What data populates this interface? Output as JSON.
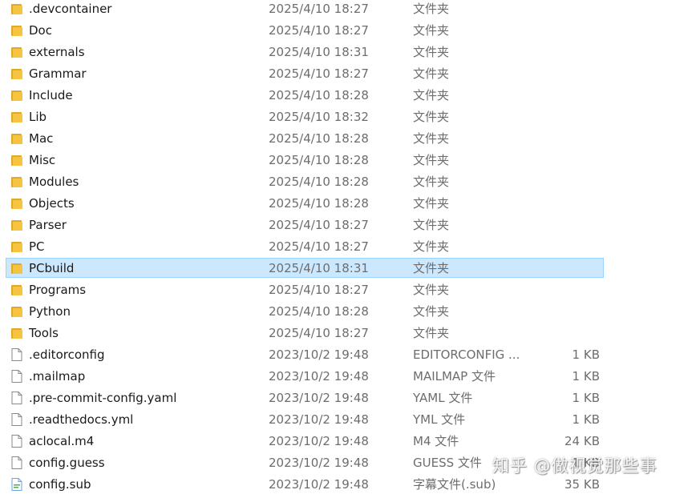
{
  "files": [
    {
      "name": ".devcontainer",
      "date": "2025/4/10 18:27",
      "type": "文件夹",
      "size": "",
      "icon": "folder-icon"
    },
    {
      "name": "Doc",
      "date": "2025/4/10 18:27",
      "type": "文件夹",
      "size": "",
      "icon": "folder-icon"
    },
    {
      "name": "externals",
      "date": "2025/4/10 18:31",
      "type": "文件夹",
      "size": "",
      "icon": "folder-icon"
    },
    {
      "name": "Grammar",
      "date": "2025/4/10 18:27",
      "type": "文件夹",
      "size": "",
      "icon": "folder-icon"
    },
    {
      "name": "Include",
      "date": "2025/4/10 18:28",
      "type": "文件夹",
      "size": "",
      "icon": "folder-icon"
    },
    {
      "name": "Lib",
      "date": "2025/4/10 18:32",
      "type": "文件夹",
      "size": "",
      "icon": "folder-icon"
    },
    {
      "name": "Mac",
      "date": "2025/4/10 18:28",
      "type": "文件夹",
      "size": "",
      "icon": "folder-icon"
    },
    {
      "name": "Misc",
      "date": "2025/4/10 18:28",
      "type": "文件夹",
      "size": "",
      "icon": "folder-icon"
    },
    {
      "name": "Modules",
      "date": "2025/4/10 18:28",
      "type": "文件夹",
      "size": "",
      "icon": "folder-icon"
    },
    {
      "name": "Objects",
      "date": "2025/4/10 18:28",
      "type": "文件夹",
      "size": "",
      "icon": "folder-icon"
    },
    {
      "name": "Parser",
      "date": "2025/4/10 18:27",
      "type": "文件夹",
      "size": "",
      "icon": "folder-icon"
    },
    {
      "name": "PC",
      "date": "2025/4/10 18:27",
      "type": "文件夹",
      "size": "",
      "icon": "folder-icon"
    },
    {
      "name": "PCbuild",
      "date": "2025/4/10 18:31",
      "type": "文件夹",
      "size": "",
      "icon": "folder-icon",
      "selected": true
    },
    {
      "name": "Programs",
      "date": "2025/4/10 18:27",
      "type": "文件夹",
      "size": "",
      "icon": "folder-icon"
    },
    {
      "name": "Python",
      "date": "2025/4/10 18:28",
      "type": "文件夹",
      "size": "",
      "icon": "folder-icon"
    },
    {
      "name": "Tools",
      "date": "2025/4/10 18:27",
      "type": "文件夹",
      "size": "",
      "icon": "folder-icon"
    },
    {
      "name": ".editorconfig",
      "date": "2023/10/2 19:48",
      "type": "EDITORCONFIG ...",
      "size": "1 KB",
      "icon": "file-icon"
    },
    {
      "name": ".mailmap",
      "date": "2023/10/2 19:48",
      "type": "MAILMAP 文件",
      "size": "1 KB",
      "icon": "file-icon"
    },
    {
      "name": ".pre-commit-config.yaml",
      "date": "2023/10/2 19:48",
      "type": "YAML 文件",
      "size": "1 KB",
      "icon": "file-icon"
    },
    {
      "name": ".readthedocs.yml",
      "date": "2023/10/2 19:48",
      "type": "YML 文件",
      "size": "1 KB",
      "icon": "file-icon"
    },
    {
      "name": "aclocal.m4",
      "date": "2023/10/2 19:48",
      "type": "M4 文件",
      "size": "24 KB",
      "icon": "file-icon"
    },
    {
      "name": "config.guess",
      "date": "2023/10/2 19:48",
      "type": "GUESS 文件",
      "size": "1 KB",
      "icon": "file-icon"
    },
    {
      "name": "config.sub",
      "date": "2023/10/2 19:48",
      "type": "字幕文件(.sub)",
      "size": "35 KB",
      "icon": "subtitle-file-icon"
    }
  ],
  "watermark": "知乎 @做视觉那些事",
  "colors": {
    "folder": "#f5c441",
    "folder_dark": "#e0a92a",
    "selection_bg": "#cce8ff",
    "selection_border": "#99d1ff",
    "secondary_text": "#6d6d6d"
  }
}
